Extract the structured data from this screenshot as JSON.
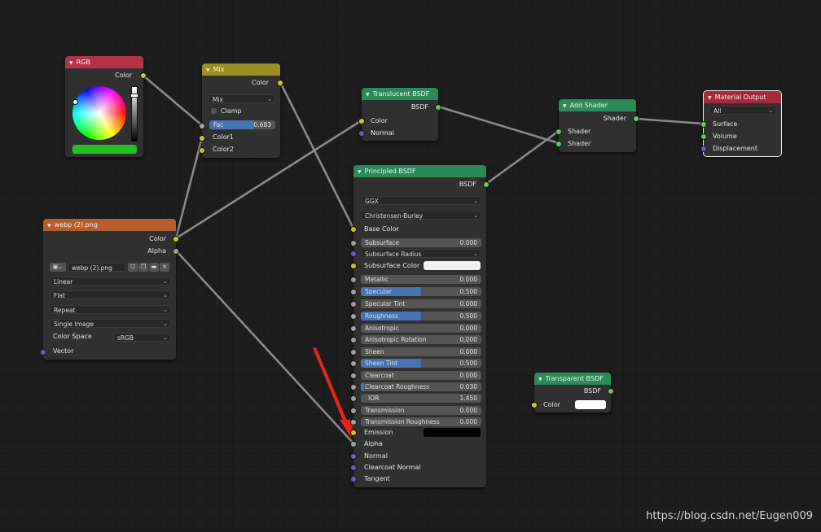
{
  "colors": {
    "header_color_input": "#b3344a",
    "header_converter": "#9c8f22",
    "header_shader": "#2a8a5a",
    "header_texture": "#b55d2c",
    "header_output": "#a52b3c",
    "socket_color": "#c7c729",
    "socket_float": "#a1a1a1",
    "socket_vector": "#6363c7",
    "socket_shader": "#63c763",
    "rgb_swatch": "#1fc21f",
    "arrow": "#e0261d"
  },
  "rgb_node": {
    "title": "RGB",
    "out_color": "Color"
  },
  "mix_node": {
    "title": "Mix",
    "out_color": "Color",
    "blend_mode": "Mix",
    "clamp_label": "Clamp",
    "fac_label": "Fac",
    "fac_value": "0.683",
    "fac_fraction": 0.683,
    "in_color1": "Color1",
    "in_color2": "Color2"
  },
  "image_node": {
    "title": "webp (2).png",
    "out_color": "Color",
    "out_alpha": "Alpha",
    "image_name": "webp (2).png",
    "interpolation": "Linear",
    "projection": "Flat",
    "extension": "Repeat",
    "source": "Single Image",
    "color_space_label": "Color Space",
    "color_space": "sRGB",
    "in_vector": "Vector"
  },
  "translucent_node": {
    "title": "Translucent BSDF",
    "out_bsdf": "BSDF",
    "in_color": "Color",
    "in_normal": "Normal"
  },
  "add_shader_node": {
    "title": "Add Shader",
    "out_shader": "Shader",
    "in_shader1": "Shader",
    "in_shader2": "Shader"
  },
  "output_node": {
    "title": "Material Output",
    "target": "All",
    "in_surface": "Surface",
    "in_volume": "Volume",
    "in_displacement": "Displacement"
  },
  "transparent_node": {
    "title": "Transparent BSDF",
    "out_bsdf": "BSDF",
    "in_color": "Color"
  },
  "principled_node": {
    "title": "Principled BSDF",
    "out_bsdf": "BSDF",
    "distribution": "GGX",
    "subsurface_method": "Christensen-Burley",
    "base_color_label": "Base Color",
    "subsurface_radius_label": "Subsurface Radius",
    "subsurface_color_label": "Subsurface Color",
    "fields": [
      {
        "label": "Subsurface",
        "value": "0.000",
        "fraction": 0
      },
      {
        "label": "Metallic",
        "value": "0.000",
        "fraction": 0
      },
      {
        "label": "Specular",
        "value": "0.500",
        "fraction": 0.5
      },
      {
        "label": "Specular Tint",
        "value": "0.000",
        "fraction": 0
      },
      {
        "label": "Roughness",
        "value": "0.500",
        "fraction": 0.5
      },
      {
        "label": "Anisotropic",
        "value": "0.000",
        "fraction": 0
      },
      {
        "label": "Anisotropic Rotation",
        "value": "0.000",
        "fraction": 0
      },
      {
        "label": "Sheen",
        "value": "0.000",
        "fraction": 0
      },
      {
        "label": "Sheen Tint",
        "value": "0.500",
        "fraction": 0.5
      },
      {
        "label": "Clearcoat",
        "value": "0.000",
        "fraction": 0
      },
      {
        "label": "Clearcoat Roughness",
        "value": "0.030",
        "fraction": 0.03
      },
      {
        "label": "IOR",
        "value": "1.450",
        "fraction": 0
      },
      {
        "label": "Transmission",
        "value": "0.000",
        "fraction": 0
      },
      {
        "label": "Transmission Roughness",
        "value": "0.000",
        "fraction": 0
      }
    ],
    "emission_label": "Emission",
    "alpha_label": "Alpha",
    "normal_label": "Normal",
    "clearcoat_normal_label": "Clearcoat Normal",
    "tangent_label": "Tangent"
  },
  "watermark": "https://blog.csdn.net/Eugen009"
}
